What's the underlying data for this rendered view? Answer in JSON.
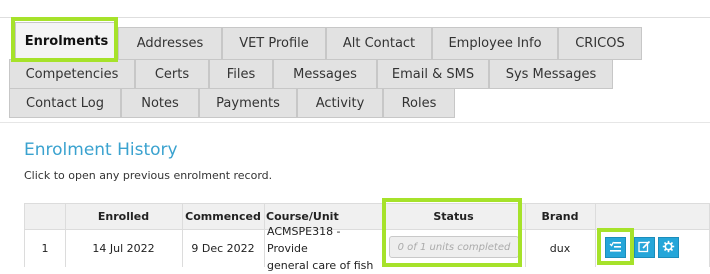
{
  "tabs": {
    "row1": [
      "Enrolments",
      "Addresses",
      "VET Profile",
      "Alt Contact",
      "Employee Info",
      "CRICOS"
    ],
    "row2": [
      "Competencies",
      "Certs",
      "Files",
      "Messages",
      "Email & SMS",
      "Sys Messages"
    ],
    "row3": [
      "Contact Log",
      "Notes",
      "Payments",
      "Activity",
      "Roles"
    ],
    "active": "Enrolments"
  },
  "section": {
    "title": "Enrolment History",
    "hint": "Click to open any previous enrolment record."
  },
  "table": {
    "headers": [
      "",
      "Enrolled",
      "Commenced",
      "Course/Unit",
      "Status",
      "Brand",
      ""
    ],
    "rows": [
      {
        "index": "1",
        "enrolled": "14 Jul 2022",
        "commenced": "9 Dec 2022",
        "course_line1": "ACMSPE318 - Provide",
        "course_line2": "general care of fish",
        "status": "0 of 1 units completed",
        "brand": "dux"
      }
    ]
  },
  "colors": {
    "highlight": "#a6e22a",
    "title": "#3aa2cf",
    "action_button": "#25a6d9"
  },
  "icons": [
    "progress-icon",
    "edit-icon",
    "gear-icon"
  ]
}
